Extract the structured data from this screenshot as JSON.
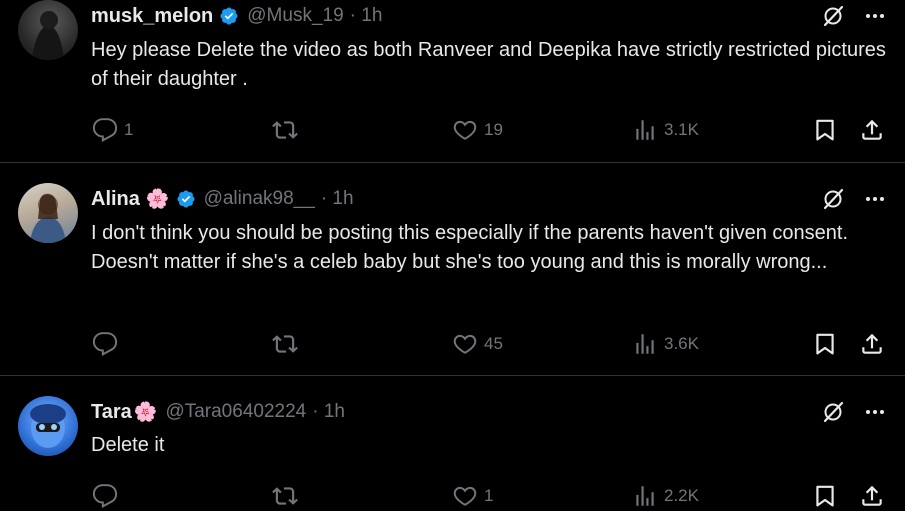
{
  "tweets": [
    {
      "name": "musk_melon",
      "flower": "",
      "handle": "@Musk_19",
      "time": "· 1h",
      "text": "Hey please Delete the video as both Ranveer and Deepika have strictly restricted pictures of their daughter .",
      "replies": "1",
      "retweets": "",
      "likes": "19",
      "views": "3.1K",
      "verified": true
    },
    {
      "name": "Alina",
      "flower": "🌸",
      "handle": "@alinak98__",
      "time": "· 1h",
      "text": "I don't think you should be posting this especially if the parents haven't given consent. Doesn't matter if she's a celeb baby but she's too young and this is morally wrong...",
      "replies": "",
      "retweets": "",
      "likes": "45",
      "views": "3.6K",
      "verified": true
    },
    {
      "name": "Tara",
      "flower": "🌸",
      "handle": "@Tara06402224",
      "time": "· 1h",
      "text": "Delete it",
      "replies": "",
      "retweets": "",
      "likes": "1",
      "views": "2.2K",
      "verified": false
    }
  ],
  "colors": {
    "background": "#000000",
    "text": "#e7e9ea",
    "muted": "#71767b",
    "verified": "#1d9bf0",
    "divider": "#2f3336"
  },
  "icons": [
    "grok-icon",
    "more-icon",
    "reply-icon",
    "retweet-icon",
    "like-icon",
    "views-icon",
    "bookmark-icon",
    "share-icon",
    "verified-badge-icon"
  ]
}
